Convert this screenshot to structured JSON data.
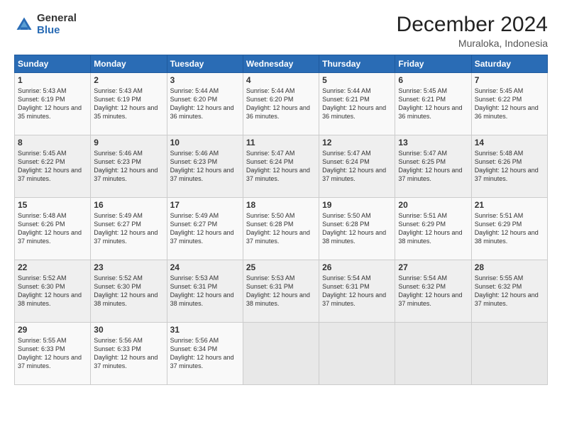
{
  "logo": {
    "general": "General",
    "blue": "Blue"
  },
  "title": "December 2024",
  "subtitle": "Muraloka, Indonesia",
  "days_header": [
    "Sunday",
    "Monday",
    "Tuesday",
    "Wednesday",
    "Thursday",
    "Friday",
    "Saturday"
  ],
  "weeks": [
    [
      {
        "day": "1",
        "sunrise": "5:43 AM",
        "sunset": "6:19 PM",
        "daylight": "12 hours and 35 minutes."
      },
      {
        "day": "2",
        "sunrise": "5:43 AM",
        "sunset": "6:19 PM",
        "daylight": "12 hours and 35 minutes."
      },
      {
        "day": "3",
        "sunrise": "5:44 AM",
        "sunset": "6:20 PM",
        "daylight": "12 hours and 36 minutes."
      },
      {
        "day": "4",
        "sunrise": "5:44 AM",
        "sunset": "6:20 PM",
        "daylight": "12 hours and 36 minutes."
      },
      {
        "day": "5",
        "sunrise": "5:44 AM",
        "sunset": "6:21 PM",
        "daylight": "12 hours and 36 minutes."
      },
      {
        "day": "6",
        "sunrise": "5:45 AM",
        "sunset": "6:21 PM",
        "daylight": "12 hours and 36 minutes."
      },
      {
        "day": "7",
        "sunrise": "5:45 AM",
        "sunset": "6:22 PM",
        "daylight": "12 hours and 36 minutes."
      }
    ],
    [
      {
        "day": "8",
        "sunrise": "5:45 AM",
        "sunset": "6:22 PM",
        "daylight": "12 hours and 37 minutes."
      },
      {
        "day": "9",
        "sunrise": "5:46 AM",
        "sunset": "6:23 PM",
        "daylight": "12 hours and 37 minutes."
      },
      {
        "day": "10",
        "sunrise": "5:46 AM",
        "sunset": "6:23 PM",
        "daylight": "12 hours and 37 minutes."
      },
      {
        "day": "11",
        "sunrise": "5:47 AM",
        "sunset": "6:24 PM",
        "daylight": "12 hours and 37 minutes."
      },
      {
        "day": "12",
        "sunrise": "5:47 AM",
        "sunset": "6:24 PM",
        "daylight": "12 hours and 37 minutes."
      },
      {
        "day": "13",
        "sunrise": "5:47 AM",
        "sunset": "6:25 PM",
        "daylight": "12 hours and 37 minutes."
      },
      {
        "day": "14",
        "sunrise": "5:48 AM",
        "sunset": "6:26 PM",
        "daylight": "12 hours and 37 minutes."
      }
    ],
    [
      {
        "day": "15",
        "sunrise": "5:48 AM",
        "sunset": "6:26 PM",
        "daylight": "12 hours and 37 minutes."
      },
      {
        "day": "16",
        "sunrise": "5:49 AM",
        "sunset": "6:27 PM",
        "daylight": "12 hours and 37 minutes."
      },
      {
        "day": "17",
        "sunrise": "5:49 AM",
        "sunset": "6:27 PM",
        "daylight": "12 hours and 37 minutes."
      },
      {
        "day": "18",
        "sunrise": "5:50 AM",
        "sunset": "6:28 PM",
        "daylight": "12 hours and 37 minutes."
      },
      {
        "day": "19",
        "sunrise": "5:50 AM",
        "sunset": "6:28 PM",
        "daylight": "12 hours and 38 minutes."
      },
      {
        "day": "20",
        "sunrise": "5:51 AM",
        "sunset": "6:29 PM",
        "daylight": "12 hours and 38 minutes."
      },
      {
        "day": "21",
        "sunrise": "5:51 AM",
        "sunset": "6:29 PM",
        "daylight": "12 hours and 38 minutes."
      }
    ],
    [
      {
        "day": "22",
        "sunrise": "5:52 AM",
        "sunset": "6:30 PM",
        "daylight": "12 hours and 38 minutes."
      },
      {
        "day": "23",
        "sunrise": "5:52 AM",
        "sunset": "6:30 PM",
        "daylight": "12 hours and 38 minutes."
      },
      {
        "day": "24",
        "sunrise": "5:53 AM",
        "sunset": "6:31 PM",
        "daylight": "12 hours and 38 minutes."
      },
      {
        "day": "25",
        "sunrise": "5:53 AM",
        "sunset": "6:31 PM",
        "daylight": "12 hours and 38 minutes."
      },
      {
        "day": "26",
        "sunrise": "5:54 AM",
        "sunset": "6:31 PM",
        "daylight": "12 hours and 37 minutes."
      },
      {
        "day": "27",
        "sunrise": "5:54 AM",
        "sunset": "6:32 PM",
        "daylight": "12 hours and 37 minutes."
      },
      {
        "day": "28",
        "sunrise": "5:55 AM",
        "sunset": "6:32 PM",
        "daylight": "12 hours and 37 minutes."
      }
    ],
    [
      {
        "day": "29",
        "sunrise": "5:55 AM",
        "sunset": "6:33 PM",
        "daylight": "12 hours and 37 minutes."
      },
      {
        "day": "30",
        "sunrise": "5:56 AM",
        "sunset": "6:33 PM",
        "daylight": "12 hours and 37 minutes."
      },
      {
        "day": "31",
        "sunrise": "5:56 AM",
        "sunset": "6:34 PM",
        "daylight": "12 hours and 37 minutes."
      },
      null,
      null,
      null,
      null
    ]
  ],
  "labels": {
    "sunrise": "Sunrise:",
    "sunset": "Sunset:",
    "daylight": "Daylight:"
  }
}
